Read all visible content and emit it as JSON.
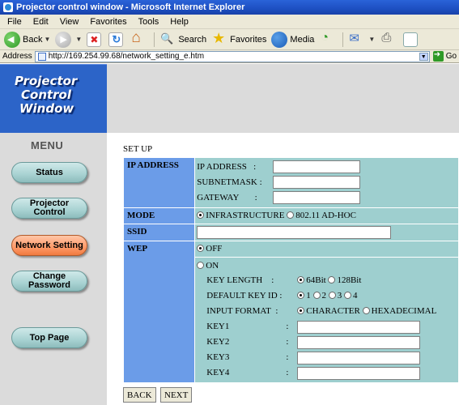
{
  "window": {
    "title": "Projector control window - Microsoft Internet Explorer"
  },
  "menubar": [
    "File",
    "Edit",
    "View",
    "Favorites",
    "Tools",
    "Help"
  ],
  "toolbar": {
    "back": "Back",
    "search": "Search",
    "favorites": "Favorites",
    "media": "Media"
  },
  "address": {
    "label": "Address",
    "url": "http://169.254.99.68/network_setting_e.htm",
    "go": "Go"
  },
  "logo": {
    "line1": "Projector",
    "line2": "Control",
    "line3": "Window"
  },
  "nav": {
    "menu_title": "MENU",
    "status": "Status",
    "projector_control_1": "Projector",
    "projector_control_2": "Control",
    "network_setting": "Network Setting",
    "change_password_1": "Change",
    "change_password_2": "Password",
    "top_page": "Top Page"
  },
  "main": {
    "title": "SET UP",
    "ip_section": {
      "header": "IP ADDRESS",
      "ip_label": "IP ADDRESS",
      "subnet_label": "SUBNETMASK",
      "gateway_label": "GATEWAY",
      "colon": ":",
      "ip_value": "",
      "subnet_value": "",
      "gateway_value": ""
    },
    "mode": {
      "header": "MODE",
      "infrastructure": "INFRASTRUCTURE",
      "adhoc": "802.11 AD-HOC",
      "selected": "INFRASTRUCTURE"
    },
    "ssid": {
      "header": "SSID",
      "value": ""
    },
    "wep": {
      "header": "WEP",
      "off": "OFF",
      "on": "ON",
      "selected": "OFF",
      "key_length_label": "KEY LENGTH",
      "key_length_64": "64Bit",
      "key_length_128": "128Bit",
      "key_length_selected": "64Bit",
      "default_key_label": "DEFAULT KEY ID",
      "default_key_options": [
        "1",
        "2",
        "3",
        "4"
      ],
      "default_key_selected": "1",
      "input_format_label": "INPUT FORMAT",
      "format_character": "CHARACTER",
      "format_hex": "HEXADECIMAL",
      "input_format_selected": "CHARACTER",
      "colon": ":",
      "key1_label": "KEY1",
      "key2_label": "KEY2",
      "key3_label": "KEY3",
      "key4_label": "KEY4"
    },
    "buttons": {
      "back": "BACK",
      "next": "NEXT"
    }
  }
}
